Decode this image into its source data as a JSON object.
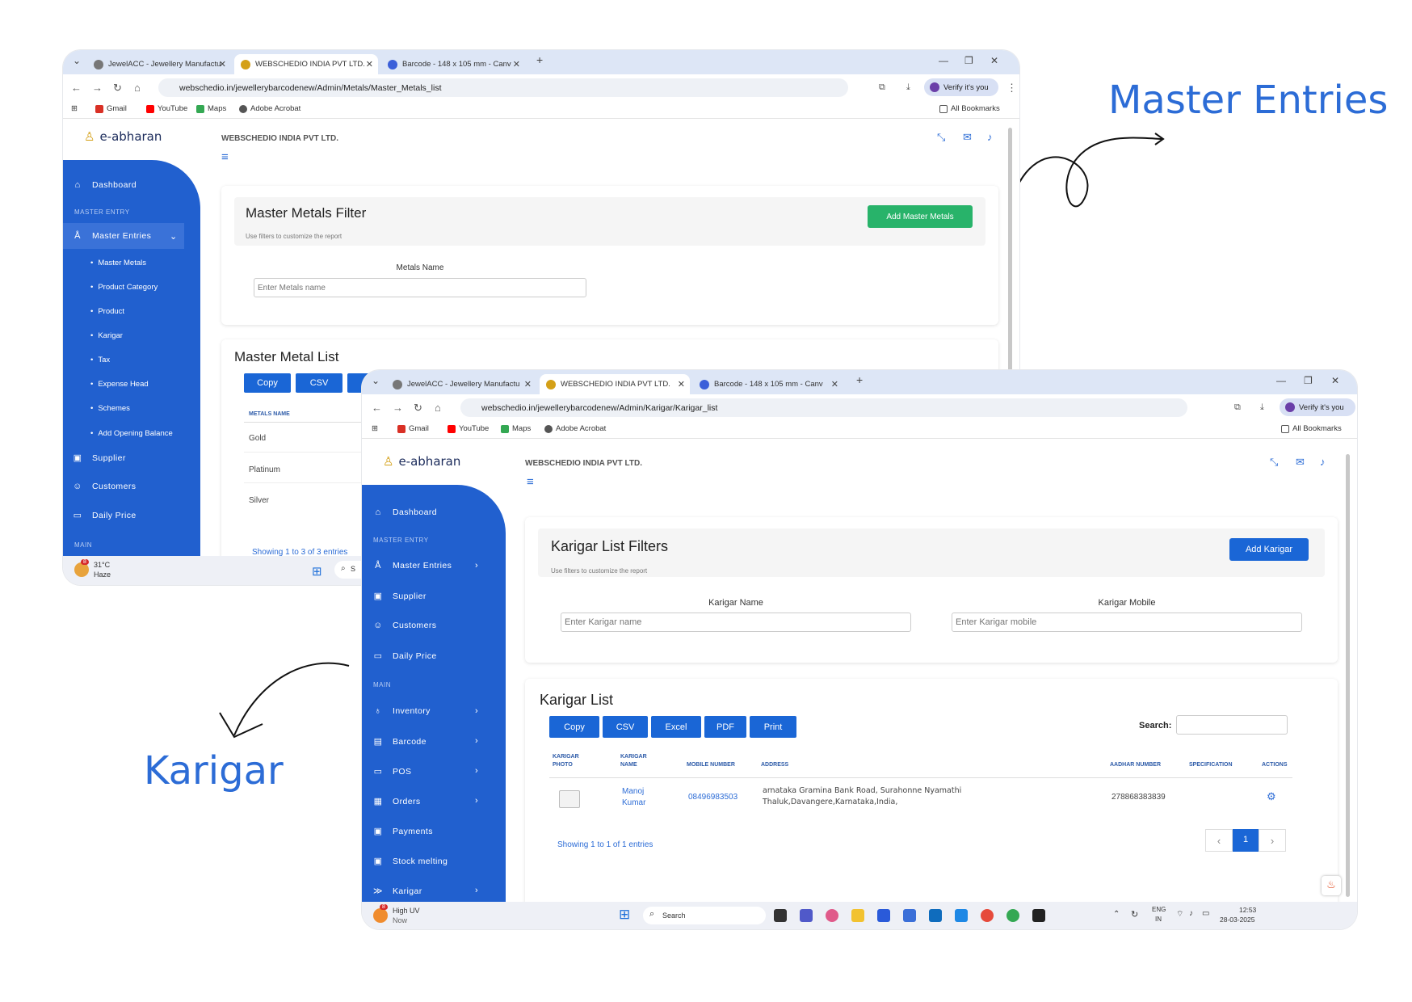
{
  "annotations": {
    "master_entries": "Master Entries",
    "karigar": "Karigar"
  },
  "browser_tabs": [
    {
      "title": "JewelACC - Jewellery Manufactu",
      "active": false
    },
    {
      "title": "WEBSCHEDIO INDIA PVT LTD.",
      "active": true
    },
    {
      "title": "Barcode - 148 x 105 mm - Canv",
      "active": false
    }
  ],
  "bookmarks": [
    "Gmail",
    "YouTube",
    "Maps",
    "Adobe Acrobat"
  ],
  "all_bookmarks": "All Bookmarks",
  "verify_label": "Verify it's you",
  "logo_text": "e-abharan",
  "company_name": "WEBSCHEDIO INDIA PVT LTD.",
  "back_window": {
    "url": "webschedio.in/jewellerybarcodenew/Admin/Metals/Master_Metals_list",
    "sidebar": {
      "dashboard": "Dashboard",
      "section_master": "MASTER ENTRY",
      "master_entries": "Master Entries",
      "sub_items": [
        "Master Metals",
        "Product Category",
        "Product",
        "Karigar",
        "Tax",
        "Expense Head",
        "Schemes",
        "Add Opening Balance"
      ],
      "supplier": "Supplier",
      "customers": "Customers",
      "daily_price": "Daily Price",
      "section_main": "MAIN"
    },
    "filter": {
      "title": "Master Metals Filter",
      "subtitle": "Use filters to customize the report",
      "add_button": "Add Master Metals",
      "field_label": "Metals Name",
      "field_placeholder": "Enter Metals name"
    },
    "list": {
      "title": "Master Metal List",
      "buttons": [
        "Copy",
        "CSV",
        "Exc"
      ],
      "column": "METALS NAME",
      "rows": [
        "Gold",
        "Platinum",
        "Silver"
      ],
      "showing": "Showing 1 to 3 of 3 entries"
    },
    "taskbar": {
      "weather_temp": "31°C",
      "weather_desc": "Haze",
      "badge": "8",
      "search_letter": "S"
    }
  },
  "front_window": {
    "url": "webschedio.in/jewellerybarcodenew/Admin/Karigar/Karigar_list",
    "sidebar": {
      "dashboard": "Dashboard",
      "section_master": "MASTER ENTRY",
      "master_entries": "Master Entries",
      "supplier": "Supplier",
      "customers": "Customers",
      "daily_price": "Daily Price",
      "section_main": "MAIN",
      "inventory": "Inventory",
      "barcode": "Barcode",
      "pos": "POS",
      "orders": "Orders",
      "payments": "Payments",
      "stock_melting": "Stock melting",
      "karigar": "Karigar"
    },
    "filter": {
      "title": "Karigar List Filters",
      "subtitle": "Use filters to customize the report",
      "add_button": "Add Karigar",
      "name_label": "Karigar Name",
      "name_placeholder": "Enter Karigar name",
      "mobile_label": "Karigar Mobile",
      "mobile_placeholder": "Enter Karigar mobile"
    },
    "list": {
      "title": "Karigar List",
      "buttons": [
        "Copy",
        "CSV",
        "Excel",
        "PDF",
        "Print"
      ],
      "search_label": "Search:",
      "columns": [
        "KARIGAR PHOTO",
        "KARIGAR NAME",
        "MOBILE NUMBER",
        "ADDRESS",
        "AADHAR NUMBER",
        "SPECIFICATION",
        "ACTIONS"
      ],
      "row": {
        "name_line1": "Manoj",
        "name_line2": "Kumar",
        "mobile": "08496983503",
        "address_line1": "arnataka Gramina Bank Road, Surahonne Nyamathi",
        "address_line2": "Thaluk,Davangere,Karnataka,India,",
        "aadhar": "278868383839"
      },
      "showing": "Showing 1 to 1 of 1 entries",
      "page": "1"
    },
    "taskbar": {
      "weather_desc": "High UV",
      "weather_sub": "Now",
      "badge": "8",
      "search": "Search",
      "lang1": "ENG",
      "lang2": "IN",
      "time": "12:53",
      "date": "28-03-2025"
    }
  },
  "colors": {
    "sidebar": "#2160cf",
    "accent": "#1a66d6",
    "green": "#28b36a",
    "annotation": "#2c6cd6"
  }
}
